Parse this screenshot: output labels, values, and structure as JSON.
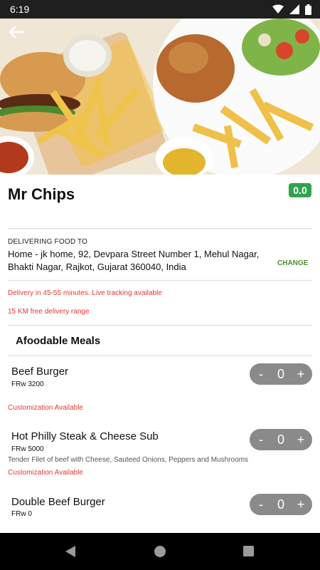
{
  "status_bar": {
    "time": "6:19"
  },
  "restaurant": {
    "name": "Mr Chips",
    "rating": "0.0"
  },
  "delivery": {
    "label": "DELIVERING FOOD TO",
    "address": "Home - jk home, 92, Devpara Street Number 1, Mehul Nagar, Bhakti Nagar, Rajkot, Gujarat 360040, India",
    "change_label": "CHANGE",
    "eta_text": "Delivery in 45-55 minutes. Live tracking available",
    "range_text": "15 KM free delivery range"
  },
  "section": {
    "title": "Afoodable Meals"
  },
  "items": [
    {
      "name": "Beef Burger",
      "price": "FRw 3200",
      "customization": "Customization Available",
      "qty": "0",
      "minus": "-",
      "plus": "+"
    },
    {
      "name": "Hot Philly Steak & Cheese Sub",
      "price": "FRw 5000",
      "description": "Tender Filet of beef with Cheese, Sauteed Onions, Peppers and Mushrooms",
      "customization": "Customization Available",
      "qty": "0",
      "minus": "-",
      "plus": "+"
    },
    {
      "name": "Double Beef Burger",
      "price": "FRw 0",
      "qty": "0",
      "minus": "-",
      "plus": "+"
    }
  ],
  "colors": {
    "accent_green": "#2ea44f",
    "change_green": "#4a8f2d",
    "alert_red": "#e53935",
    "stepper_gray": "#8a8a8a"
  }
}
